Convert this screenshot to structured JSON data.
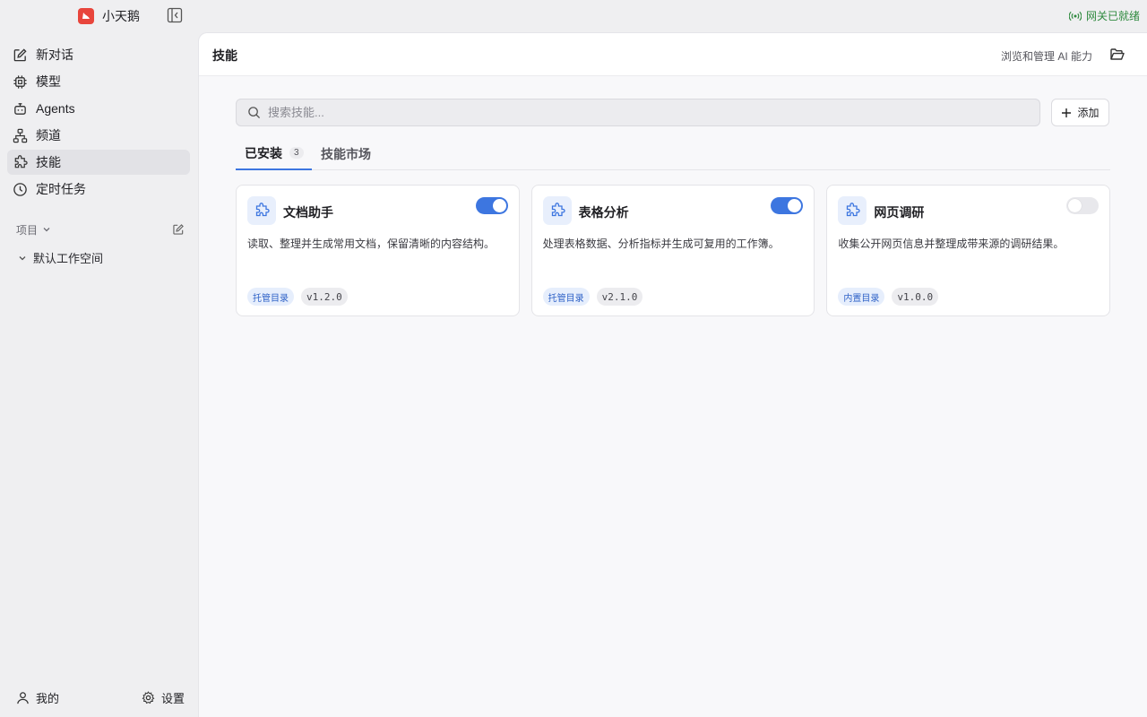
{
  "app": {
    "name": "小天鹅",
    "logo_color": "#e8453c"
  },
  "gateway": {
    "status": "网关已就绪",
    "color": "#2f8a3f"
  },
  "sidebar": {
    "items": [
      {
        "label": "新对话",
        "icon": "edit-icon"
      },
      {
        "label": "模型",
        "icon": "chip-icon"
      },
      {
        "label": "Agents",
        "icon": "bot-icon"
      },
      {
        "label": "频道",
        "icon": "network-icon"
      },
      {
        "label": "技能",
        "icon": "puzzle-icon",
        "active": true
      },
      {
        "label": "定时任务",
        "icon": "clock-icon"
      }
    ],
    "section_title": "项目",
    "workspace": "默认工作空间",
    "me": "我的",
    "settings": "设置"
  },
  "header": {
    "title": "技能",
    "description": "浏览和管理 AI 能力"
  },
  "search": {
    "placeholder": "搜索技能...",
    "value": ""
  },
  "add_label": "添加",
  "tabs": [
    {
      "label": "已安装",
      "count": "3",
      "active": true
    },
    {
      "label": "技能市场"
    }
  ],
  "skills": [
    {
      "name": "文档助手",
      "description": "读取、整理并生成常用文档，保留清晰的内容结构。",
      "source": "托管目录",
      "version": "v1.2.0",
      "enabled": true
    },
    {
      "name": "表格分析",
      "description": "处理表格数据、分析指标并生成可复用的工作簿。",
      "source": "托管目录",
      "version": "v2.1.0",
      "enabled": true
    },
    {
      "name": "网页调研",
      "description": "收集公开网页信息并整理成带来源的调研结果。",
      "source": "内置目录",
      "version": "v1.0.0",
      "enabled": false
    }
  ],
  "accent_color": "#3d76e0"
}
